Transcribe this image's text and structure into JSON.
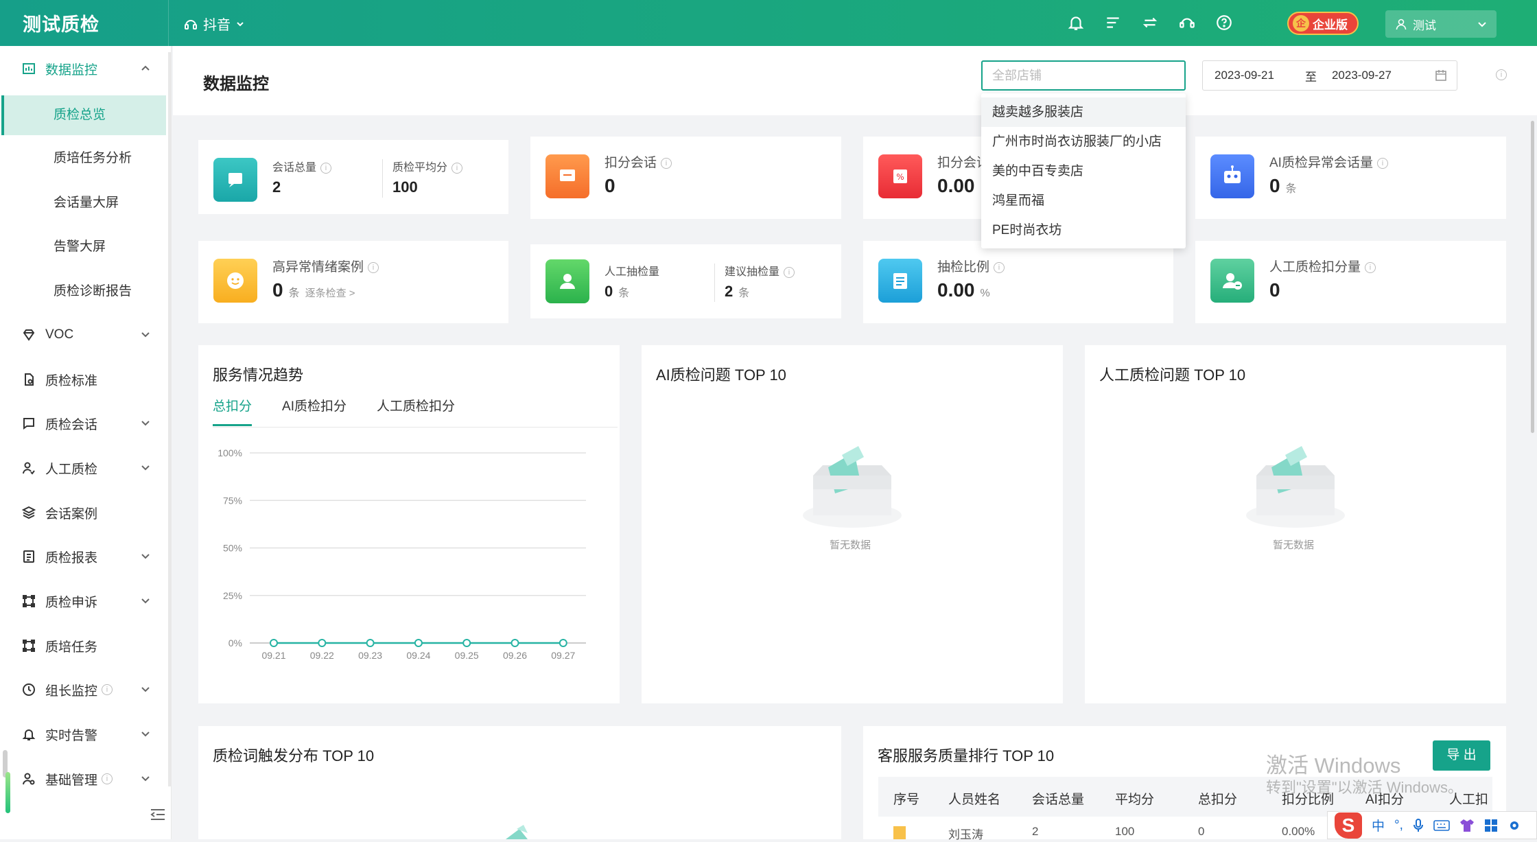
{
  "app": {
    "brand": "测试质检",
    "platform": "抖音",
    "edition": "企业版",
    "user": "测试"
  },
  "sidebar": {
    "items": [
      {
        "label": "数据监控"
      },
      {
        "label": "VOC"
      },
      {
        "label": "质检标准"
      },
      {
        "label": "质检会话"
      },
      {
        "label": "人工质检"
      },
      {
        "label": "会话案例"
      },
      {
        "label": "质检报表"
      },
      {
        "label": "质检申诉"
      },
      {
        "label": "质培任务"
      },
      {
        "label": "组长监控"
      },
      {
        "label": "实时告警"
      },
      {
        "label": "基础管理"
      }
    ],
    "sub_items": [
      {
        "label": "质检总览"
      },
      {
        "label": "质培任务分析"
      },
      {
        "label": "会话量大屏"
      },
      {
        "label": "告警大屏"
      },
      {
        "label": "质检诊断报告"
      }
    ]
  },
  "header": {
    "title": "数据监控",
    "shop_placeholder": "全部店铺",
    "date_start": "2023-09-21",
    "date_sep": "至",
    "date_end": "2023-09-27"
  },
  "shop_dropdown": [
    "越卖越多服装店",
    "广州市时尚衣访服装厂的小店",
    "美的中百专卖店",
    "鸿星而福",
    "PE时尚衣坊"
  ],
  "stats": {
    "total_sessions": {
      "label": "会话总量",
      "value": "2"
    },
    "avg_score": {
      "label": "质检平均分",
      "value": "100"
    },
    "deduct_sessions": {
      "label": "扣分会话",
      "value": "0"
    },
    "deduct_rate": {
      "label": "扣分会话",
      "value": "0.00"
    },
    "ai_abnormal": {
      "label": "AI质检异常会话量",
      "value": "0",
      "unit": "条"
    },
    "high_abnormal": {
      "label": "高异常情绪案例",
      "value": "0",
      "unit": "条",
      "link": "逐条检查 >"
    },
    "manual_sample": {
      "label": "人工抽检量",
      "value": "0",
      "unit": "条"
    },
    "suggest_sample": {
      "label": "建议抽检量",
      "value": "2",
      "unit": "条"
    },
    "sample_ratio": {
      "label": "抽检比例",
      "value": "0.00",
      "unit": "%"
    },
    "manual_deduct": {
      "label": "人工质检扣分量",
      "value": "0"
    }
  },
  "trend": {
    "title": "服务情况趋势",
    "tabs": [
      "总扣分",
      "AI质检扣分",
      "人工质检扣分"
    ]
  },
  "chart_data": {
    "type": "line",
    "x": [
      "09.21",
      "09.22",
      "09.23",
      "09.24",
      "09.25",
      "09.26",
      "09.27"
    ],
    "series": [
      {
        "values": [
          0,
          0,
          0,
          0,
          0,
          0,
          0
        ]
      }
    ],
    "y_ticks": [
      "0%",
      "25%",
      "50%",
      "75%",
      "100%"
    ],
    "ylim": [
      0,
      100
    ],
    "grid": true
  },
  "ai_top10": {
    "title": "AI质检问题 TOP 10",
    "empty": "暂无数据"
  },
  "manual_top10": {
    "title": "人工质检问题 TOP 10",
    "empty": "暂无数据"
  },
  "word_top10": {
    "title": "质检词触发分布 TOP 10"
  },
  "ranking": {
    "title": "客服服务质量排行 TOP 10",
    "export": "导 出",
    "columns": [
      "序号",
      "人员姓名",
      "会话总量",
      "平均分",
      "总扣分",
      "扣分比例",
      "AI扣分",
      "人工扣分"
    ],
    "row": [
      "刘玉涛",
      "2",
      "100",
      "0",
      "0.00%"
    ]
  },
  "watermark": {
    "line1": "激活 Windows",
    "line2": "转到\"设置\"以激活 Windows。"
  },
  "ime": {
    "lang": "中",
    "punct": "°,"
  },
  "colors": {
    "brand": "#16a38a",
    "topbar": "#1aa77e"
  }
}
